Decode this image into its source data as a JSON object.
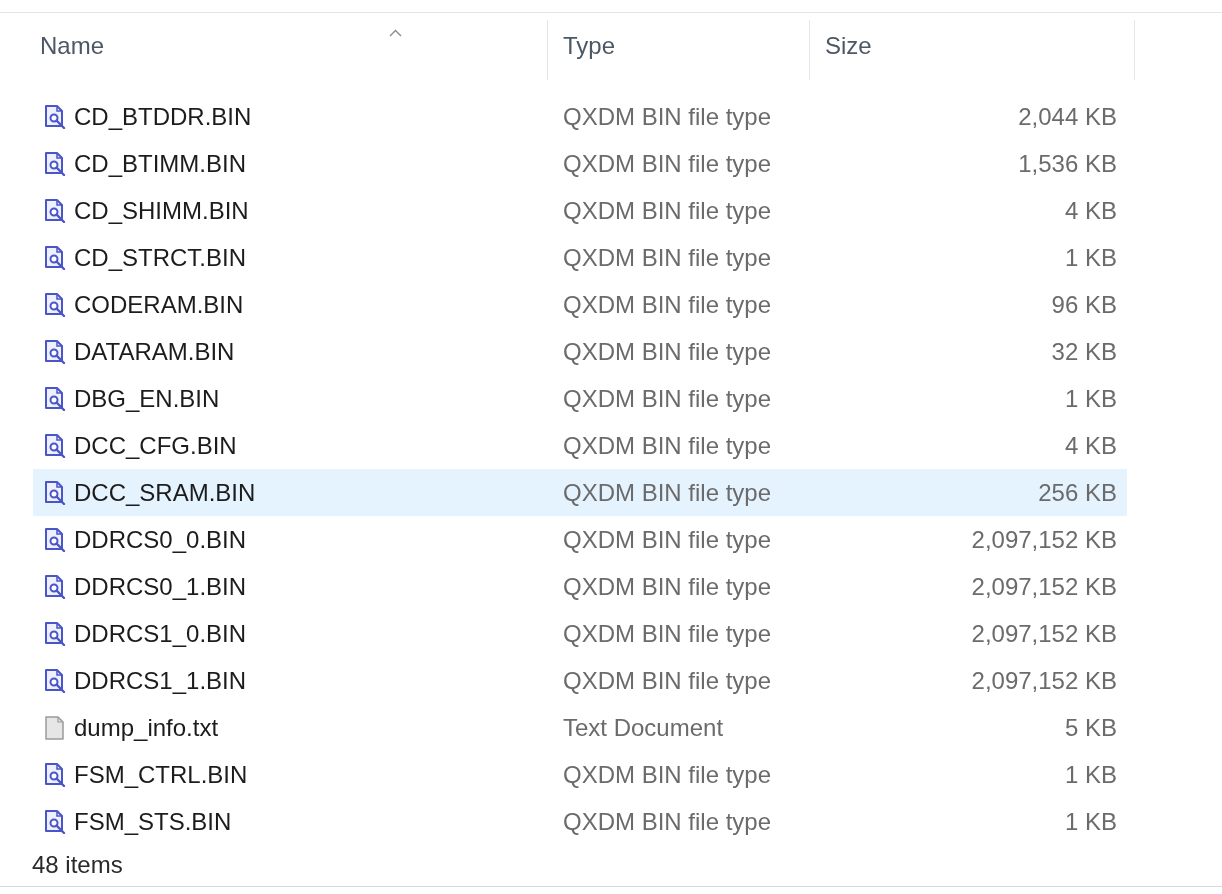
{
  "header": {
    "columns": [
      {
        "label": "Name",
        "sorted": true
      },
      {
        "label": "Type",
        "sorted": false
      },
      {
        "label": "Size",
        "sorted": false
      }
    ]
  },
  "rows": [
    {
      "kind": "bin",
      "name": "CD_BTDDR.BIN",
      "type": "QXDM BIN file type",
      "size": "2,044 KB",
      "selected": false
    },
    {
      "kind": "bin",
      "name": "CD_BTIMM.BIN",
      "type": "QXDM BIN file type",
      "size": "1,536 KB",
      "selected": false
    },
    {
      "kind": "bin",
      "name": "CD_SHIMM.BIN",
      "type": "QXDM BIN file type",
      "size": "4 KB",
      "selected": false
    },
    {
      "kind": "bin",
      "name": "CD_STRCT.BIN",
      "type": "QXDM BIN file type",
      "size": "1 KB",
      "selected": false
    },
    {
      "kind": "bin",
      "name": "CODERAM.BIN",
      "type": "QXDM BIN file type",
      "size": "96 KB",
      "selected": false
    },
    {
      "kind": "bin",
      "name": "DATARAM.BIN",
      "type": "QXDM BIN file type",
      "size": "32 KB",
      "selected": false
    },
    {
      "kind": "bin",
      "name": "DBG_EN.BIN",
      "type": "QXDM BIN file type",
      "size": "1 KB",
      "selected": false
    },
    {
      "kind": "bin",
      "name": "DCC_CFG.BIN",
      "type": "QXDM BIN file type",
      "size": "4 KB",
      "selected": false
    },
    {
      "kind": "bin",
      "name": "DCC_SRAM.BIN",
      "type": "QXDM BIN file type",
      "size": "256 KB",
      "selected": true
    },
    {
      "kind": "bin",
      "name": "DDRCS0_0.BIN",
      "type": "QXDM BIN file type",
      "size": "2,097,152 KB",
      "selected": false
    },
    {
      "kind": "bin",
      "name": "DDRCS0_1.BIN",
      "type": "QXDM BIN file type",
      "size": "2,097,152 KB",
      "selected": false
    },
    {
      "kind": "bin",
      "name": "DDRCS1_0.BIN",
      "type": "QXDM BIN file type",
      "size": "2,097,152 KB",
      "selected": false
    },
    {
      "kind": "bin",
      "name": "DDRCS1_1.BIN",
      "type": "QXDM BIN file type",
      "size": "2,097,152 KB",
      "selected": false
    },
    {
      "kind": "text",
      "name": "dump_info.txt",
      "type": "Text Document",
      "size": "5 KB",
      "selected": false
    },
    {
      "kind": "bin",
      "name": "FSM_CTRL.BIN",
      "type": "QXDM BIN file type",
      "size": "1 KB",
      "selected": false
    },
    {
      "kind": "bin",
      "name": "FSM_STS.BIN",
      "type": "QXDM BIN file type",
      "size": "1 KB",
      "selected": false
    }
  ],
  "status_bar": {
    "item_count": "48 items"
  }
}
